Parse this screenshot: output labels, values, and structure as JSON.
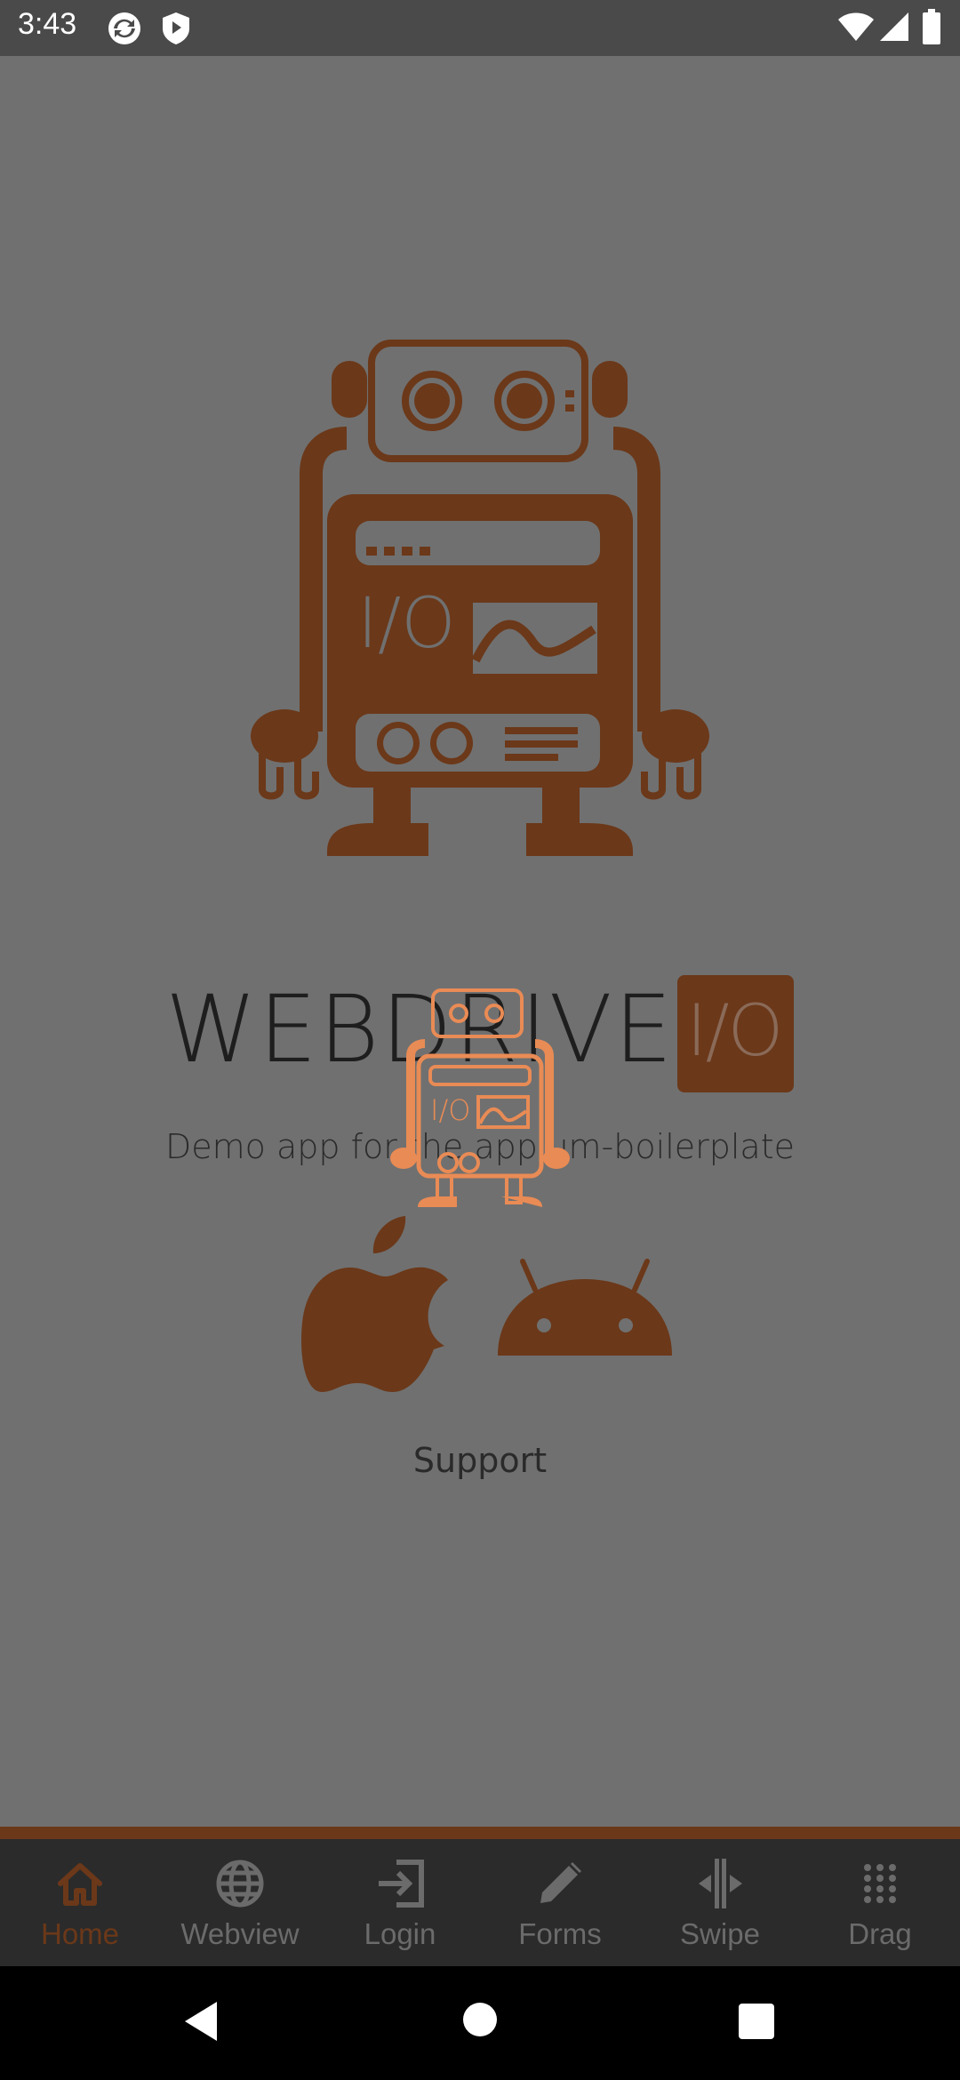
{
  "status_bar": {
    "time": "3:43",
    "left_icons": [
      "sync-icon",
      "shield-icon"
    ],
    "right_icons": [
      "wifi-icon",
      "signal-icon",
      "battery-icon"
    ]
  },
  "hero": {
    "logo_text": "WEBDRIVER",
    "logo_badge": "I/O",
    "subtitle": "Demo app for the appium-boilerplate",
    "support_label": "Support",
    "platform_icons": [
      "apple-icon",
      "android-icon"
    ]
  },
  "tabs": [
    {
      "label": "Home",
      "icon": "home-icon",
      "active": true
    },
    {
      "label": "Webview",
      "icon": "globe-icon",
      "active": false
    },
    {
      "label": "Login",
      "icon": "login-icon",
      "active": false
    },
    {
      "label": "Forms",
      "icon": "pencil-icon",
      "active": false
    },
    {
      "label": "Swipe",
      "icon": "swipe-icon",
      "active": false
    },
    {
      "label": "Drag",
      "icon": "drag-icon",
      "active": false
    }
  ],
  "nav_bar": {
    "buttons": [
      "back-icon",
      "home-circle-icon",
      "recents-icon"
    ]
  },
  "colors": {
    "accent": "#6b3819",
    "accent_light": "#e98b55",
    "overlay_bg": "#707070",
    "tab_bar_bg": "#2b2b2b"
  }
}
